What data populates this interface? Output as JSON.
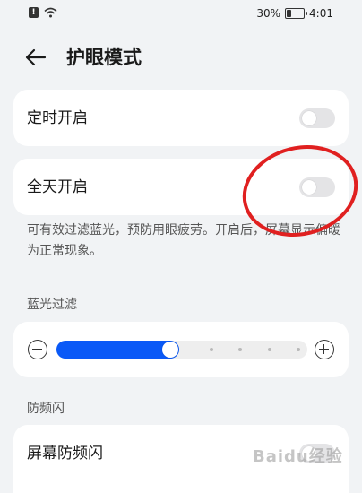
{
  "status_bar": {
    "battery": "30%",
    "time": "4:01"
  },
  "header": {
    "title": "护眼模式"
  },
  "settings": {
    "scheduled": {
      "label": "定时开启",
      "on": false
    },
    "all_day": {
      "label": "全天开启",
      "on": false
    },
    "description": "可有效过滤蓝光，预防用眼疲劳。开启后，屏幕显示偏暖为正常现象。"
  },
  "blue_light": {
    "section_title": "蓝光过滤",
    "level": 0.45,
    "steps": 8
  },
  "anti_flicker": {
    "section_title": "防频闪",
    "screen": {
      "label": "屏幕防频闪",
      "on": false
    }
  },
  "colors": {
    "accent": "#0a59f7",
    "annotation": "#e02020"
  },
  "watermark": "Baidu经验"
}
